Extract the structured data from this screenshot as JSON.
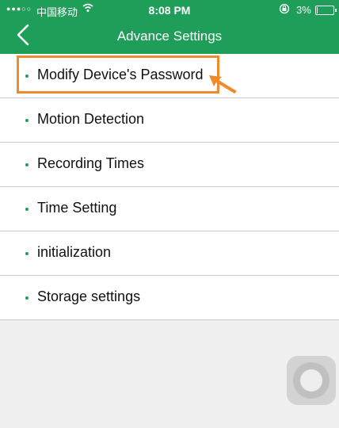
{
  "status_bar": {
    "signal": "●●●○○",
    "carrier": "中国移动",
    "wifi_icon": "wifi-icon",
    "time": "8:08 PM",
    "lock_icon": "rotation-lock-icon",
    "battery_pct": "3%",
    "battery_level": 0.03
  },
  "nav": {
    "back_icon": "chevron-left-icon",
    "title": "Advance Settings"
  },
  "menu": {
    "items": [
      {
        "label": "Modify Device's Password"
      },
      {
        "label": "Motion Detection"
      },
      {
        "label": "Recording Times"
      },
      {
        "label": "Time Setting"
      },
      {
        "label": "initialization"
      },
      {
        "label": "Storage settings"
      }
    ]
  },
  "colors": {
    "header": "#1e9e58",
    "highlight": "#f08a2a",
    "bullet": "#1e9e58"
  },
  "overlay": {
    "assistive_icon": "assistive-touch-icon"
  }
}
